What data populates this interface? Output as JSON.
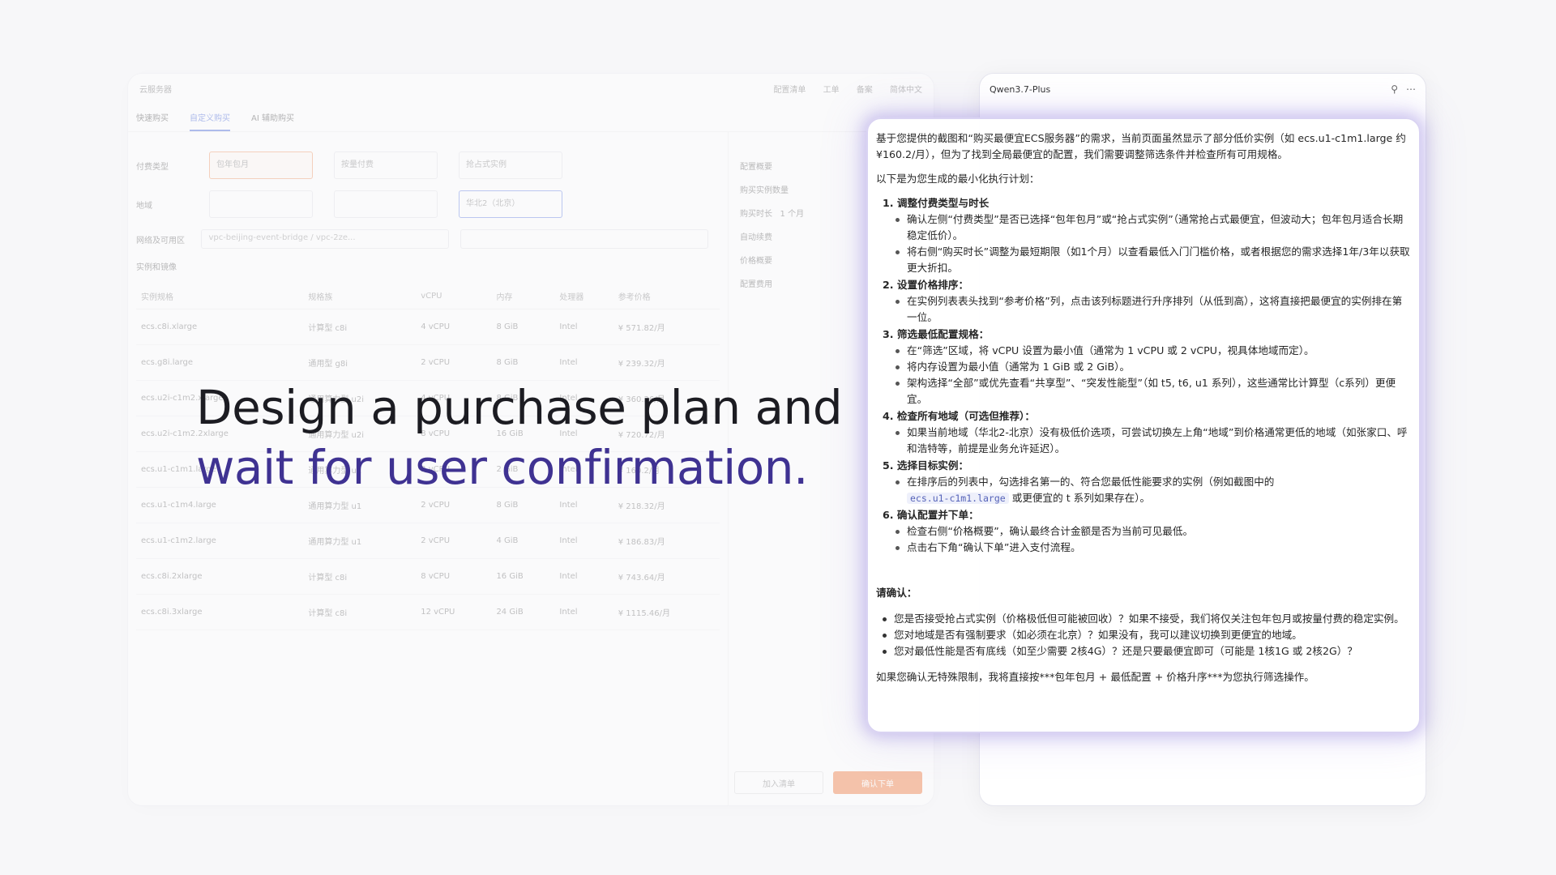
{
  "console": {
    "breadcrumb": "云服务器",
    "top_links": [
      "配置清单",
      "工单",
      "备案",
      "简体中文"
    ],
    "tabs": [
      "快速购买",
      "自定义购买",
      "AI 辅助购买"
    ],
    "labels": {
      "billing": "付费类型",
      "region": "地域",
      "network": "网络及可用区",
      "instance": "实例和镜像",
      "instance_label": "实例"
    },
    "billing_options": [
      "包年包月",
      "按量付费",
      "抢占式实例"
    ],
    "region_options": [
      "华北2（北京）"
    ],
    "vpc_value": "vpc-beijing-event-bridge / vpc-2ze...",
    "table_headers": [
      "实例规格",
      "规格族",
      "vCPU",
      "内存",
      "处理器",
      "参考价格"
    ],
    "table_rows": [
      [
        "ecs.c8i.xlarge",
        "计算型 c8i",
        "4 vCPU",
        "8 GiB",
        "Intel",
        "¥ 571.82/月"
      ],
      [
        "ecs.g8i.large",
        "通用型 g8i",
        "2 vCPU",
        "8 GiB",
        "Intel",
        "¥ 239.32/月"
      ],
      [
        "ecs.u2i-c1m2.xlarge",
        "通用算力型 u2i",
        "4 vCPU",
        "8 GiB",
        "Intel",
        "¥ 360.36/月"
      ],
      [
        "ecs.u2i-c1m2.2xlarge",
        "通用算力型 u2i",
        "8 vCPU",
        "16 GiB",
        "Intel",
        "¥ 720.72/月"
      ],
      [
        "ecs.u1-c1m1.large",
        "通用算力型 u1",
        "2 vCPU",
        "2 GiB",
        "Intel",
        "¥ 160.2/月"
      ],
      [
        "ecs.u1-c1m4.large",
        "通用算力型 u1",
        "2 vCPU",
        "8 GiB",
        "Intel",
        "¥ 218.32/月"
      ],
      [
        "ecs.u1-c1m2.large",
        "通用算力型 u1",
        "2 vCPU",
        "4 GiB",
        "Intel",
        "¥ 186.83/月"
      ],
      [
        "ecs.c8i.2xlarge",
        "计算型 c8i",
        "8 vCPU",
        "16 GiB",
        "Intel",
        "¥ 743.64/月"
      ],
      [
        "ecs.c8i.3xlarge",
        "计算型 c8i",
        "12 vCPU",
        "24 GiB",
        "Intel",
        "¥ 1115.46/月"
      ]
    ],
    "summary": {
      "title": "配置概要",
      "quantity": "购买实例数量",
      "duration": "购买时长",
      "duration_value": "1 个月",
      "auto_renew": "自动续费",
      "price_title": "价格概要",
      "config_fee": "配置费用"
    },
    "buttons": {
      "add_to_list": "加入清单",
      "confirm_order": "确认下单"
    }
  },
  "chat": {
    "model_name": "Qwen3.7-Plus",
    "intro": "基于您提供的截图和“购买最便宜ECS服务器”的需求，当前页面虽然显示了部分低价实例（如 ecs.u1-c1m1.large 约 ¥160.2/月），但为了找到全局最便宜的配置，我们需要调整筛选条件并检查所有可用规格。",
    "subtitle": "以下是为您生成的最小化执行计划：",
    "steps": [
      {
        "title": "1. 调整付费类型与时长",
        "bullets": [
          "确认左侧“付费类型”是否已选择“包年包月”或“抢占式实例”（通常抢占式最便宜，但波动大；包年包月适合长期稳定低价）。",
          "将右侧“购买时长”调整为最短期限（如1个月）以查看最低入门门槛价格，或者根据您的需求选择1年/3年以获取更大折扣。"
        ]
      },
      {
        "title": "2. 设置价格排序：",
        "bullets": [
          "在实例列表表头找到“参考价格”列，点击该列标题进行升序排列（从低到高），这将直接把最便宜的实例排在第一位。"
        ]
      },
      {
        "title": "3. 筛选最低配置规格：",
        "bullets": [
          "在“筛选”区域，将 vCPU 设置为最小值（通常为 1 vCPU 或 2 vCPU，视具体地域而定）。",
          "将内存设置为最小值（通常为 1 GiB 或 2 GiB）。",
          "架构选择“全部”或优先查看“共享型”、“突发性能型”（如 t5, t6, u1 系列），这些通常比计算型（c系列）更便宜。"
        ]
      },
      {
        "title": "4. 检查所有地域（可选但推荐）：",
        "bullets": [
          "如果当前地域（华北2-北京）没有极低价选项，可尝试切换左上角“地域”到价格通常更低的地域（如张家口、呼和浩特等，前提是业务允许延迟）。"
        ]
      },
      {
        "title": "5. 选择目标实例：",
        "bullets": [
          "在排序后的列表中，勾选排名第一的、符合您最低性能要求的实例（例如截图中的"
        ],
        "code": "ecs.u1-c1m1.large",
        "code_tail": "或更便宜的 t 系列如果存在）。"
      },
      {
        "title": "6. 确认配置并下单：",
        "bullets": [
          "检查右侧“价格概要”，确认最终合计金额是否为当前可见最低。",
          "点击右下角“确认下单”进入支付流程。"
        ]
      }
    ],
    "confirm_title": "请确认：",
    "questions": [
      "您是否接受抢占式实例（价格极低但可能被回收）？如果不接受，我们将仅关注包年包月或按量付费的稳定实例。",
      "您对地域是否有强制要求（如必须在北京）？如果没有，我可以建议切换到更便宜的地域。",
      "您对最低性能是否有底线（如至少需要 2核4G）？还是只要最便宜即可（可能是 1核1G 或 2核2G）？"
    ],
    "closing": "如果您确认无特殊限制，我将直接按***包年包月 + 最低配置 + 价格升序***为您执行筛选操作。"
  },
  "headline": {
    "line1": "Design a purchase plan and",
    "line2": "wait for user confirmation."
  },
  "colors": {
    "accent_purple": "#3f3292",
    "glow": "#8c78dc",
    "order_button": "#f07b3f"
  }
}
